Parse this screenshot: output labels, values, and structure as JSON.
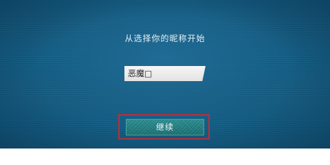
{
  "screen": {
    "prompt": "从选择你的昵称开始",
    "name_input": {
      "value": "恶魔□"
    },
    "continue_button": {
      "label": "继续"
    }
  },
  "colors": {
    "background": "#165e84",
    "input_background": "#f0f0f0",
    "button_background": "#1e7a7e",
    "focus_outline": "#b3323c"
  }
}
